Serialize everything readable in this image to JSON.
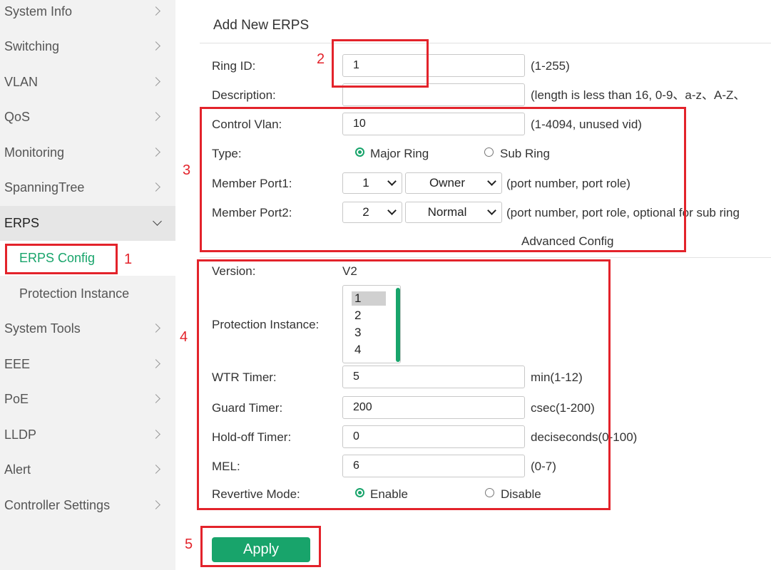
{
  "sidebar": {
    "items": [
      {
        "label": "System Info"
      },
      {
        "label": "Switching"
      },
      {
        "label": "VLAN"
      },
      {
        "label": "QoS"
      },
      {
        "label": "Monitoring"
      },
      {
        "label": "SpanningTree"
      },
      {
        "label": "ERPS"
      },
      {
        "label": "ERPS Config"
      },
      {
        "label": "Protection Instance"
      },
      {
        "label": "System Tools"
      },
      {
        "label": "EEE"
      },
      {
        "label": "PoE"
      },
      {
        "label": "LLDP"
      },
      {
        "label": "Alert"
      },
      {
        "label": "Controller Settings"
      }
    ]
  },
  "form": {
    "title": "Add New ERPS",
    "ring_id": {
      "label": "Ring ID:",
      "value": "1",
      "hint": "(1-255)"
    },
    "description": {
      "label": "Description:",
      "value": "",
      "hint": "(length is less than 16, 0-9、a-z、A-Z、"
    },
    "control_vlan": {
      "label": "Control Vlan:",
      "value": "10",
      "hint": "(1-4094, unused vid)"
    },
    "type": {
      "label": "Type:",
      "options": [
        "Major Ring",
        "Sub Ring"
      ],
      "selected": "Major Ring"
    },
    "member_port1": {
      "label": "Member Port1:",
      "port": "1",
      "role": "Owner",
      "hint": "(port number, port role)"
    },
    "member_port2": {
      "label": "Member Port2:",
      "port": "2",
      "role": "Normal",
      "hint": "(port number, port role, optional for sub ring"
    },
    "advanced_config": "Advanced Config",
    "version": {
      "label": "Version:",
      "value": "V2"
    },
    "protection_instance": {
      "label": "Protection Instance:",
      "options": [
        "1",
        "2",
        "3",
        "4"
      ],
      "selected": "1"
    },
    "wtr_timer": {
      "label": "WTR Timer:",
      "value": "5",
      "hint": "min(1-12)"
    },
    "guard_timer": {
      "label": "Guard Timer:",
      "value": "200",
      "hint": "csec(1-200)"
    },
    "holdoff_timer": {
      "label": "Hold-off Timer:",
      "value": "0",
      "hint": "deciseconds(0-100)"
    },
    "mel": {
      "label": "MEL:",
      "value": "6",
      "hint": "(0-7)"
    },
    "revertive_mode": {
      "label": "Revertive Mode:",
      "options": [
        "Enable",
        "Disable"
      ],
      "selected": "Enable"
    },
    "apply_label": "Apply"
  },
  "annotations": {
    "n1": "1",
    "n2": "2",
    "n3": "3",
    "n4": "4",
    "n5": "5"
  },
  "colors": {
    "accent": "#18a46b",
    "annotation": "#e3232b",
    "sidebar_bg": "#f2f2f2"
  }
}
